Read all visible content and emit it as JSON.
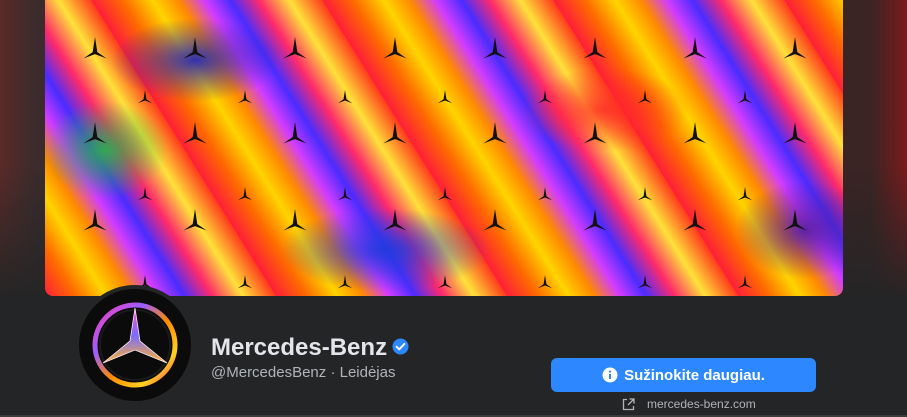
{
  "cover": {
    "alt_icon": "mercedes-star-pattern"
  },
  "profile": {
    "name": "Mercedes-Benz",
    "verified_icon": "verified-badge-icon",
    "handle_line": "@MercedesBenz · Leidėjas",
    "avatar_icon": "mercedes-star-logo"
  },
  "actions": {
    "cta_label": "Sužinokite daugiau.",
    "cta_icon": "info-icon",
    "website_text": "mercedes-benz.com",
    "website_icon": "external-link-icon"
  },
  "colors": {
    "accent": "#2d88ff",
    "background": "#242526",
    "primary_text": "#e4e6eb",
    "secondary_text": "#b0b3b8"
  }
}
